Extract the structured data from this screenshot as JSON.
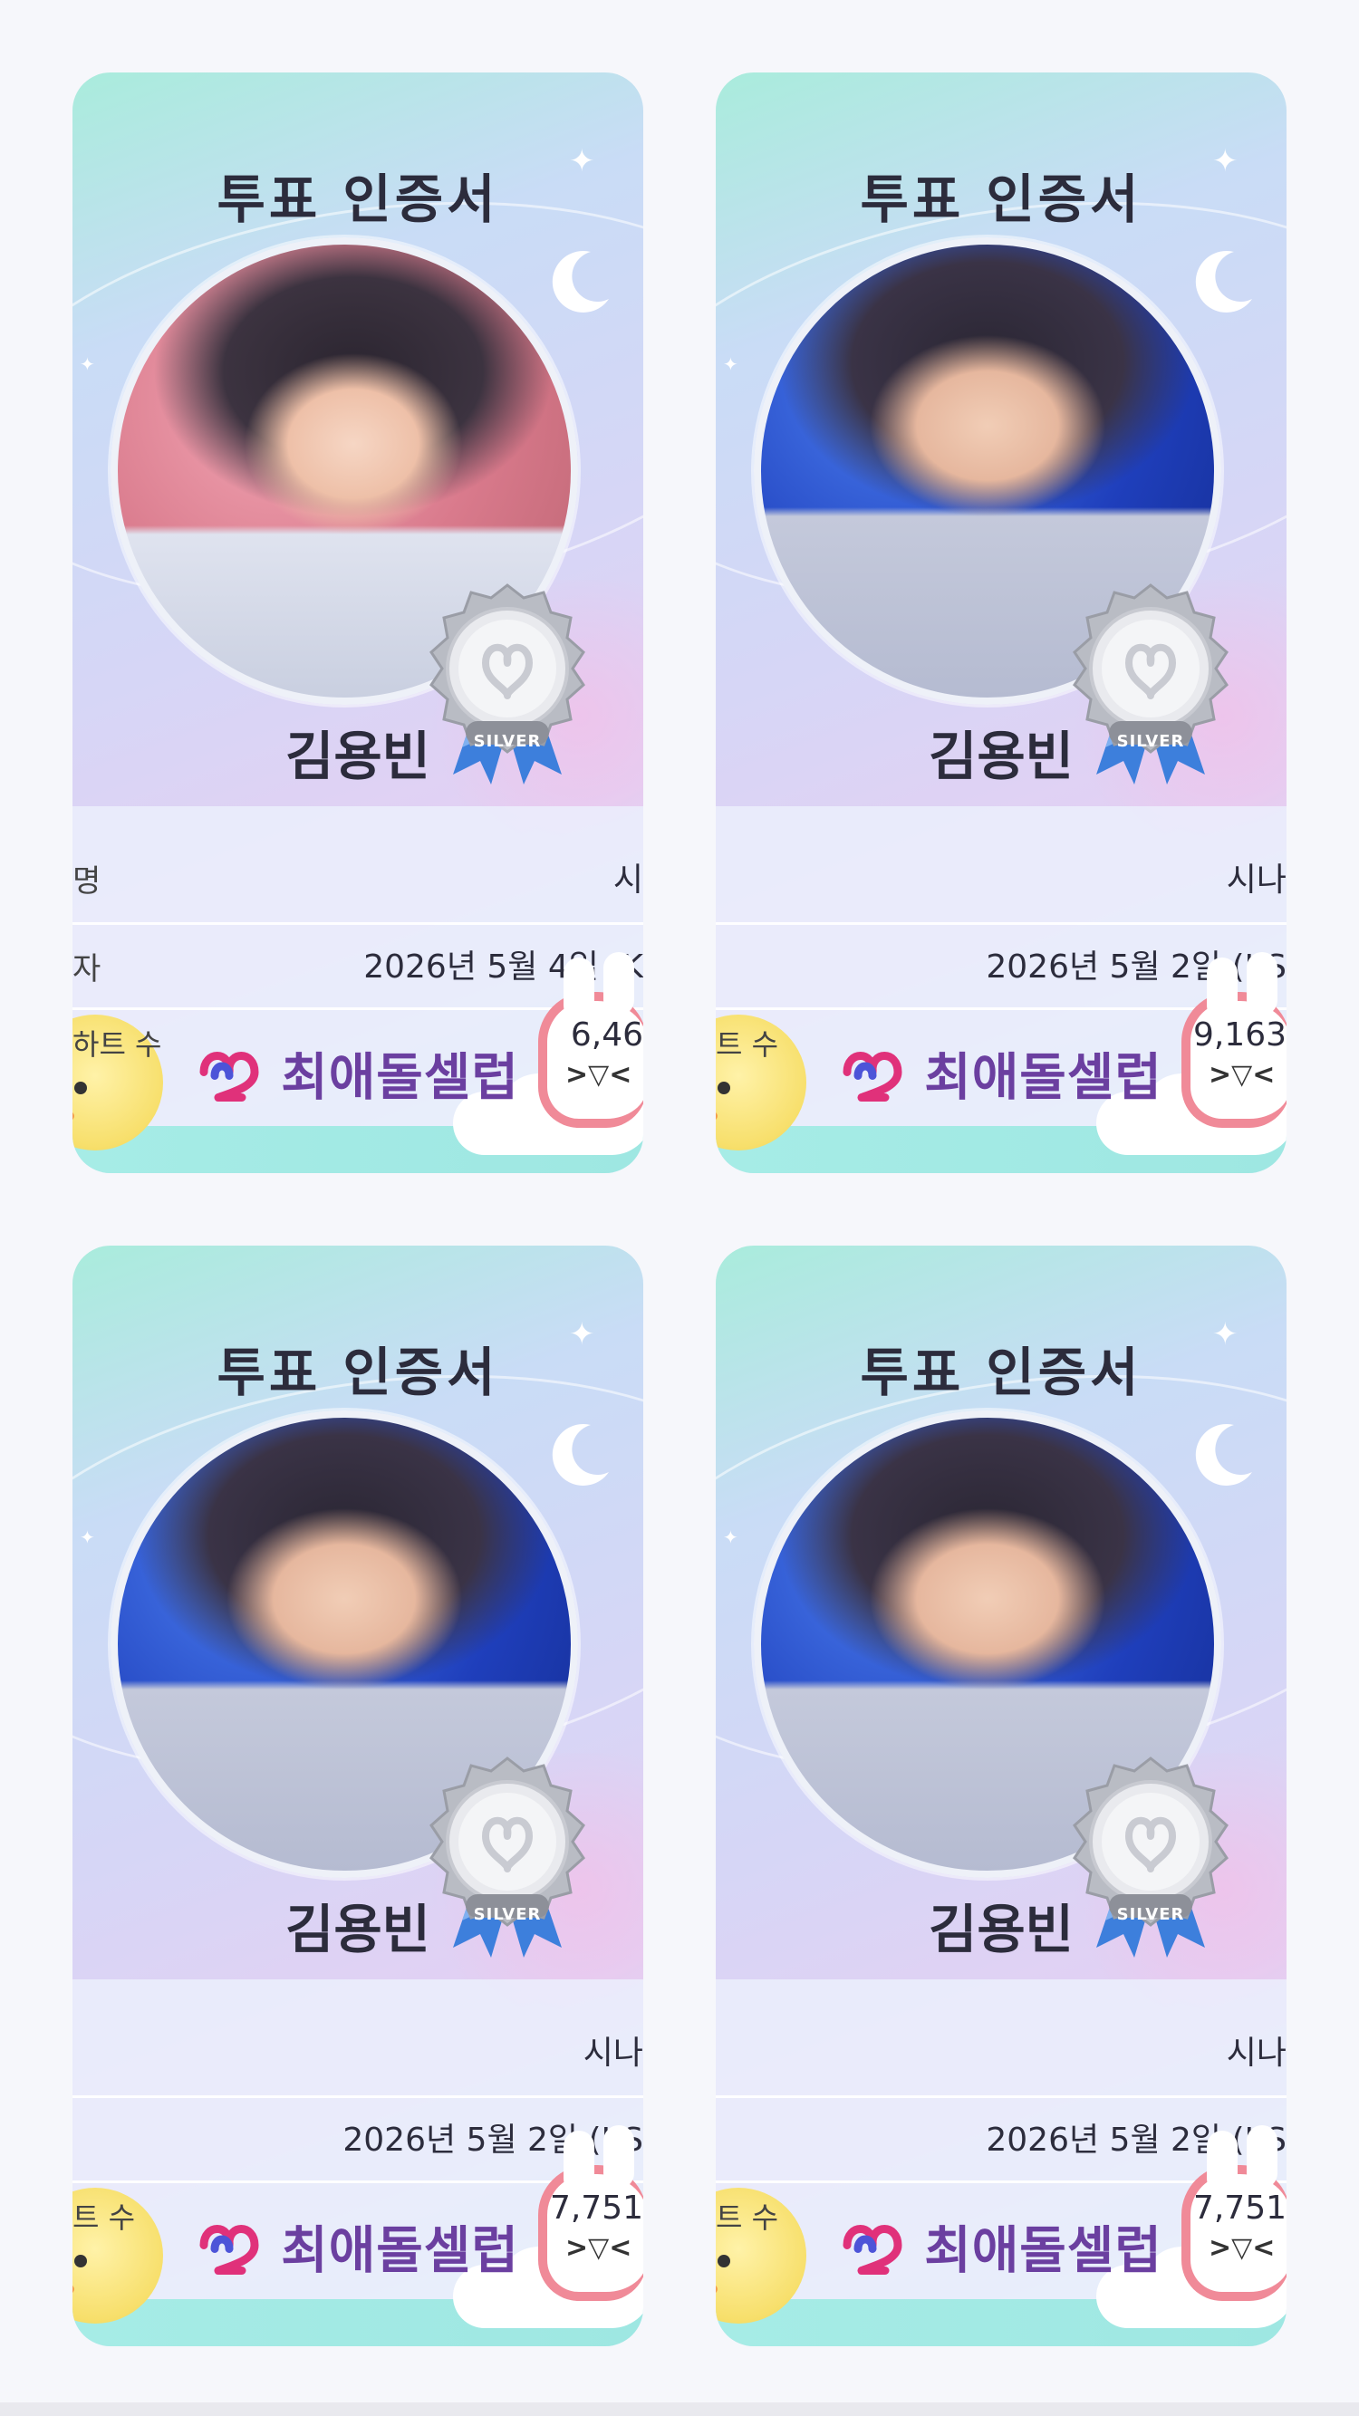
{
  "brand": {
    "name": "최애돌셀럽"
  },
  "cards": [
    {
      "title": "투표 인증서",
      "name": "김용빈",
      "medal": "SILVER",
      "row1_label": "명",
      "row1_value": "시",
      "row2_label": "자",
      "row2_value": "2026년 5월 4일 (K",
      "heart_label": "하트 수",
      "heart_value": "6,46"
    },
    {
      "title": "투표 인증서",
      "name": "김용빈",
      "medal": "SILVER",
      "row1_label": "",
      "row1_value": "시나",
      "row2_label": "",
      "row2_value": "2026년 5월 2일 (KS",
      "heart_label": "트 수",
      "heart_value": "9,163"
    },
    {
      "title": "투표 인증서",
      "name": "김용빈",
      "medal": "SILVER",
      "row1_label": "",
      "row1_value": "시나",
      "row2_label": "",
      "row2_value": "2026년 5월 2일 (KS",
      "heart_label": "트 수",
      "heart_value": "7,751"
    },
    {
      "title": "투표 인증서",
      "name": "김용빈",
      "medal": "SILVER",
      "row1_label": "",
      "row1_value": "시나",
      "row2_label": "",
      "row2_value": "2026년 5월 2일 (KS",
      "heart_label": "트 수",
      "heart_value": "7,751"
    }
  ],
  "colors": {
    "brand": "#6b3fa0",
    "accent_heart": "#e0317a",
    "medal_ribbon": "#3d7fdc"
  },
  "icons": [
    "moon-icon",
    "sparkle-icon",
    "silver-medal-icon",
    "brand-heart-logo-icon",
    "chick-mascot-icon",
    "bunny-mascot-icon"
  ]
}
